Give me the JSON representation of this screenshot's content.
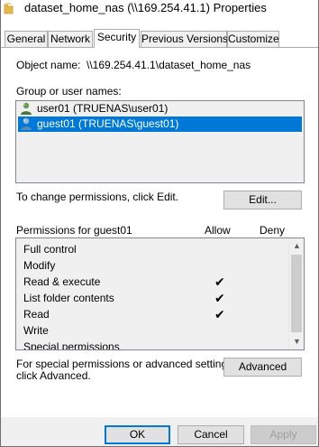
{
  "window": {
    "title": "dataset_home_nas (\\\\169.254.41.1) Properties",
    "icon": "folder-icon"
  },
  "tabs": [
    {
      "label": "General",
      "active": false
    },
    {
      "label": "Network",
      "active": false
    },
    {
      "label": "Security",
      "active": true
    },
    {
      "label": "Previous Versions",
      "active": false
    },
    {
      "label": "Customize",
      "active": false
    }
  ],
  "security": {
    "object_name_label": "Object name:",
    "object_name_value": "\\\\169.254.41.1\\dataset_home_nas",
    "group_label": "Group or user names:",
    "groups": [
      {
        "name": "user01 (TRUENAS\\user01)",
        "selected": false,
        "icon": "user-icon"
      },
      {
        "name": "guest01 (TRUENAS\\guest01)",
        "selected": true,
        "icon": "user-icon"
      }
    ],
    "change_text": "To change permissions, click Edit.",
    "edit_button": "Edit...",
    "permissions_for": "Permissions for guest01",
    "allow_header": "Allow",
    "deny_header": "Deny",
    "permissions": [
      {
        "name": "Full control",
        "allow": false,
        "deny": false
      },
      {
        "name": "Modify",
        "allow": false,
        "deny": false
      },
      {
        "name": "Read & execute",
        "allow": true,
        "deny": false
      },
      {
        "name": "List folder contents",
        "allow": true,
        "deny": false
      },
      {
        "name": "Read",
        "allow": true,
        "deny": false
      },
      {
        "name": "Write",
        "allow": false,
        "deny": false
      },
      {
        "name": "Special permissions",
        "allow": false,
        "deny": false
      }
    ],
    "advanced_text_1": "For special permissions or advanced settings,",
    "advanced_text_2": "click Advanced.",
    "advanced_button": "Advanced"
  },
  "footer": {
    "ok": "OK",
    "cancel": "Cancel",
    "apply": "Apply"
  },
  "colors": {
    "selection": "#0078d7",
    "dialog_bg": "#f0f0f0"
  }
}
